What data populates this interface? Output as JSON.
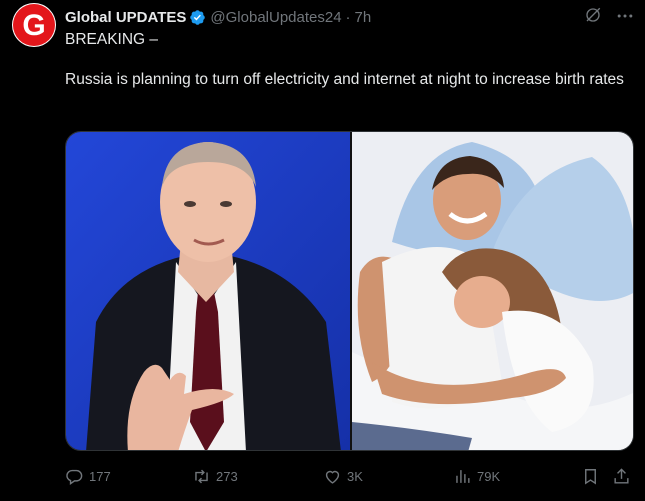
{
  "tweet": {
    "author": {
      "display_name": "Global UPDATES",
      "handle": "@GlobalUpdates24",
      "verified": true,
      "avatar_letter": "G"
    },
    "separator": "·",
    "time": "7h",
    "text_line1": "BREAKING –",
    "text_line2": "Russia is planning to turn off electricity and internet at night to increase birth rates",
    "media": [
      {
        "icon": "photo-man-in-suit"
      },
      {
        "icon": "photo-couple-in-bed"
      }
    ],
    "actions": {
      "replies": "177",
      "reposts": "273",
      "likes": "3K",
      "views": "79K"
    }
  },
  "colors": {
    "background": "#000000",
    "text": "#e7e9ea",
    "muted": "#71767b",
    "verified": "#1d9bf0",
    "avatar_red": "#e3161b"
  }
}
